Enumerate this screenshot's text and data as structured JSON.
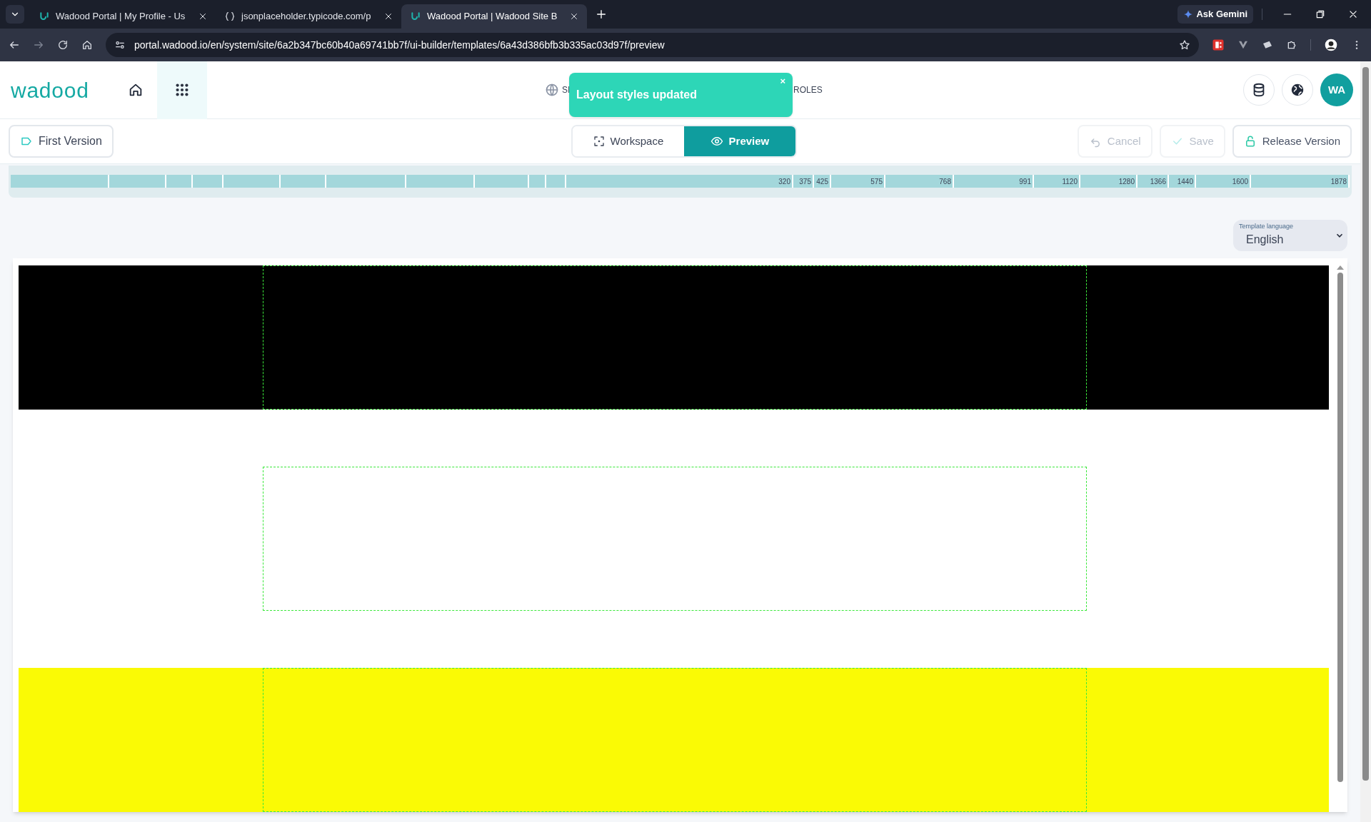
{
  "browser": {
    "tabs": [
      {
        "title": "Wadood Portal | My Profile - Us",
        "kind": "wadood",
        "selected": false
      },
      {
        "title": "jsonplaceholder.typicode.com/p",
        "kind": "json",
        "selected": false
      },
      {
        "title": "Wadood Portal | Wadood Site B",
        "kind": "wadood",
        "selected": true
      }
    ],
    "address": "portal.wadood.io/en/system/site/6a2b347bc60b40a69741bb7f/ui-builder/templates/6a43d386bfb3b335ac03d97f/preview",
    "gemini": "Ask Gemini"
  },
  "header": {
    "logo": "wadood",
    "nav": [
      {
        "label": "SI",
        "kind": "sites"
      },
      {
        "label": "ROLES",
        "kind": "roles"
      }
    ],
    "avatar": "WA"
  },
  "toast": {
    "message": "Layout styles updated",
    "close": "×"
  },
  "toolbar": {
    "version": "First Version",
    "views": [
      {
        "label": "Workspace",
        "kind": "workspace",
        "selected": false
      },
      {
        "label": "Preview",
        "kind": "preview",
        "selected": true
      }
    ],
    "actions": [
      {
        "label": "Cancel",
        "kind": "cancel",
        "disabled": true
      },
      {
        "label": "Save",
        "kind": "save",
        "disabled": true
      },
      {
        "label": "Release Version",
        "kind": "release",
        "disabled": false
      }
    ]
  },
  "ruler": [
    "320",
    "375",
    "425",
    "575",
    "768",
    "991",
    "1120",
    "1280",
    "1366",
    "1440",
    "1600",
    "1878"
  ],
  "template_language": {
    "label": "Template language",
    "value": "English"
  },
  "preview": {
    "sections": [
      {
        "color": "#000000"
      },
      {
        "color": "#ffffff"
      },
      {
        "color": "#fafa05"
      }
    ]
  }
}
